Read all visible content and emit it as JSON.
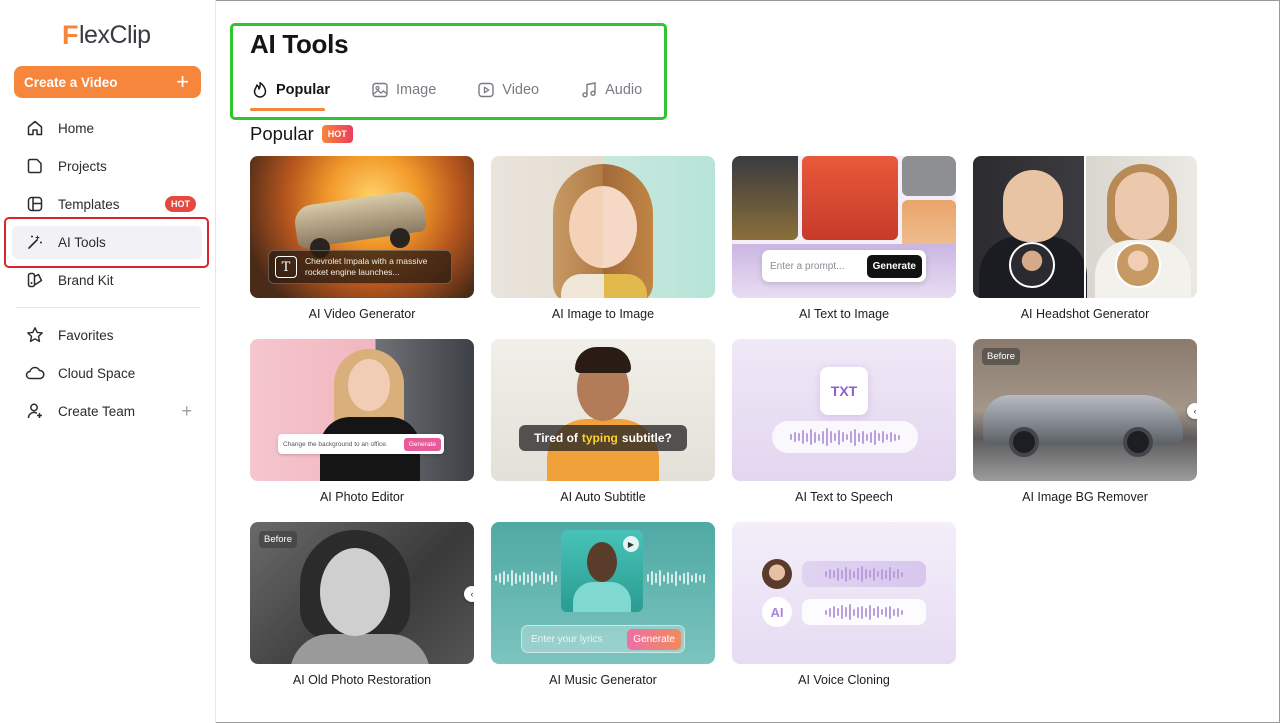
{
  "sidebar": {
    "logo": {
      "mark": "F",
      "text": "lexClip"
    },
    "create_button": {
      "label": "Create a Video",
      "icon": "plus-icon"
    },
    "items": [
      {
        "label": "Home",
        "icon": "home-icon"
      },
      {
        "label": "Projects",
        "icon": "projects-icon"
      },
      {
        "label": "Templates",
        "icon": "templates-icon",
        "badge": "HOT"
      },
      {
        "label": "AI Tools",
        "icon": "magic-wand-icon",
        "active": true
      },
      {
        "label": "Brand Kit",
        "icon": "brand-kit-icon"
      }
    ],
    "secondary_items": [
      {
        "label": "Favorites",
        "icon": "star-icon"
      },
      {
        "label": "Cloud Space",
        "icon": "cloud-icon"
      },
      {
        "label": "Create Team",
        "icon": "add-user-icon",
        "action": "+"
      }
    ]
  },
  "header": {
    "title": "AI Tools",
    "tabs": [
      {
        "label": "Popular",
        "icon": "fire-icon",
        "active": true
      },
      {
        "label": "Image",
        "icon": "image-icon"
      },
      {
        "label": "Video",
        "icon": "video-icon"
      },
      {
        "label": "Audio",
        "icon": "music-note-icon"
      }
    ]
  },
  "section": {
    "title": "Popular",
    "badge": "HOT"
  },
  "cards": [
    {
      "label": "AI Video Generator",
      "caption": "Chevrolet Impala with a massive rocket engine launches...",
      "caption_icon": "T"
    },
    {
      "label": "AI Image to Image"
    },
    {
      "label": "AI Text to Image",
      "prompt_placeholder": "Enter a prompt...",
      "button": "Generate"
    },
    {
      "label": "AI Headshot Generator"
    },
    {
      "label": "AI Photo Editor",
      "prompt_text": "Change the background to an office.",
      "button": "Generate"
    },
    {
      "label": "AI Auto Subtitle",
      "subtitle_pre": "Tired of",
      "subtitle_highlight": "typing",
      "subtitle_post": "subtitle?"
    },
    {
      "label": "AI Text to Speech",
      "doc_label": "TXT"
    },
    {
      "label": "AI Image BG Remover",
      "tag": "Before"
    },
    {
      "label": "AI Old Photo Restoration",
      "tag": "Before"
    },
    {
      "label": "AI Music Generator",
      "prompt_placeholder": "Enter your lyrics",
      "button": "Generate"
    },
    {
      "label": "AI Voice Cloning",
      "avatar_text": "AI"
    }
  ],
  "colors": {
    "accent": "#f6863b",
    "hot_badge": "#e5483f",
    "highlight_green": "#2ec52e",
    "highlight_red": "#d8262c"
  }
}
